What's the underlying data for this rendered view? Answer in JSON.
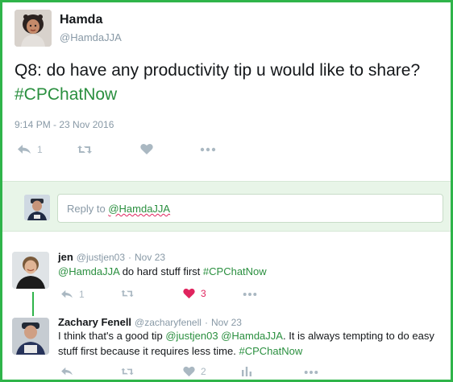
{
  "tweet": {
    "author_name": "Hamda",
    "author_handle": "@HamdaJJA",
    "text_plain": "Q8: do have any productivity tip u would like to share?",
    "hashtag": "#CPChatNow",
    "timestamp": "9:14 PM - 23 Nov 2016",
    "reply_count": "1"
  },
  "reply_box": {
    "prefix": "Reply to",
    "mention": "@HamdaJJA"
  },
  "replies": [
    {
      "name": "jen",
      "handle": "@justjen03",
      "separator": "·",
      "date": "Nov 23",
      "mention": "@HamdaJJA",
      "text": "do hard stuff first",
      "hashtag": "#CPChatNow",
      "reply_count": "1",
      "like_count": "3"
    },
    {
      "name": "Zachary Fenell",
      "handle": "@zacharyfenell",
      "separator": "·",
      "date": "Nov 23",
      "text_a": "I think that's a good tip",
      "mention_1": "@justjen03",
      "mention_2": "@HamdaJJA",
      "text_b": ". It is always tempting to do easy",
      "text_c": "stuff first because it requires less time.",
      "hashtag": "#CPChatNow",
      "like_count": "2"
    }
  ],
  "colors": {
    "frame": "#2fb44a",
    "link": "#2a8f3f",
    "muted": "#8899a6",
    "icon": "#aab8c2",
    "like_red": "#e0245e",
    "reply_bar_bg": "#e8f5e8"
  },
  "icons": [
    "reply-icon",
    "retweet-icon",
    "heart-icon",
    "more-icon",
    "analytics-icon"
  ]
}
